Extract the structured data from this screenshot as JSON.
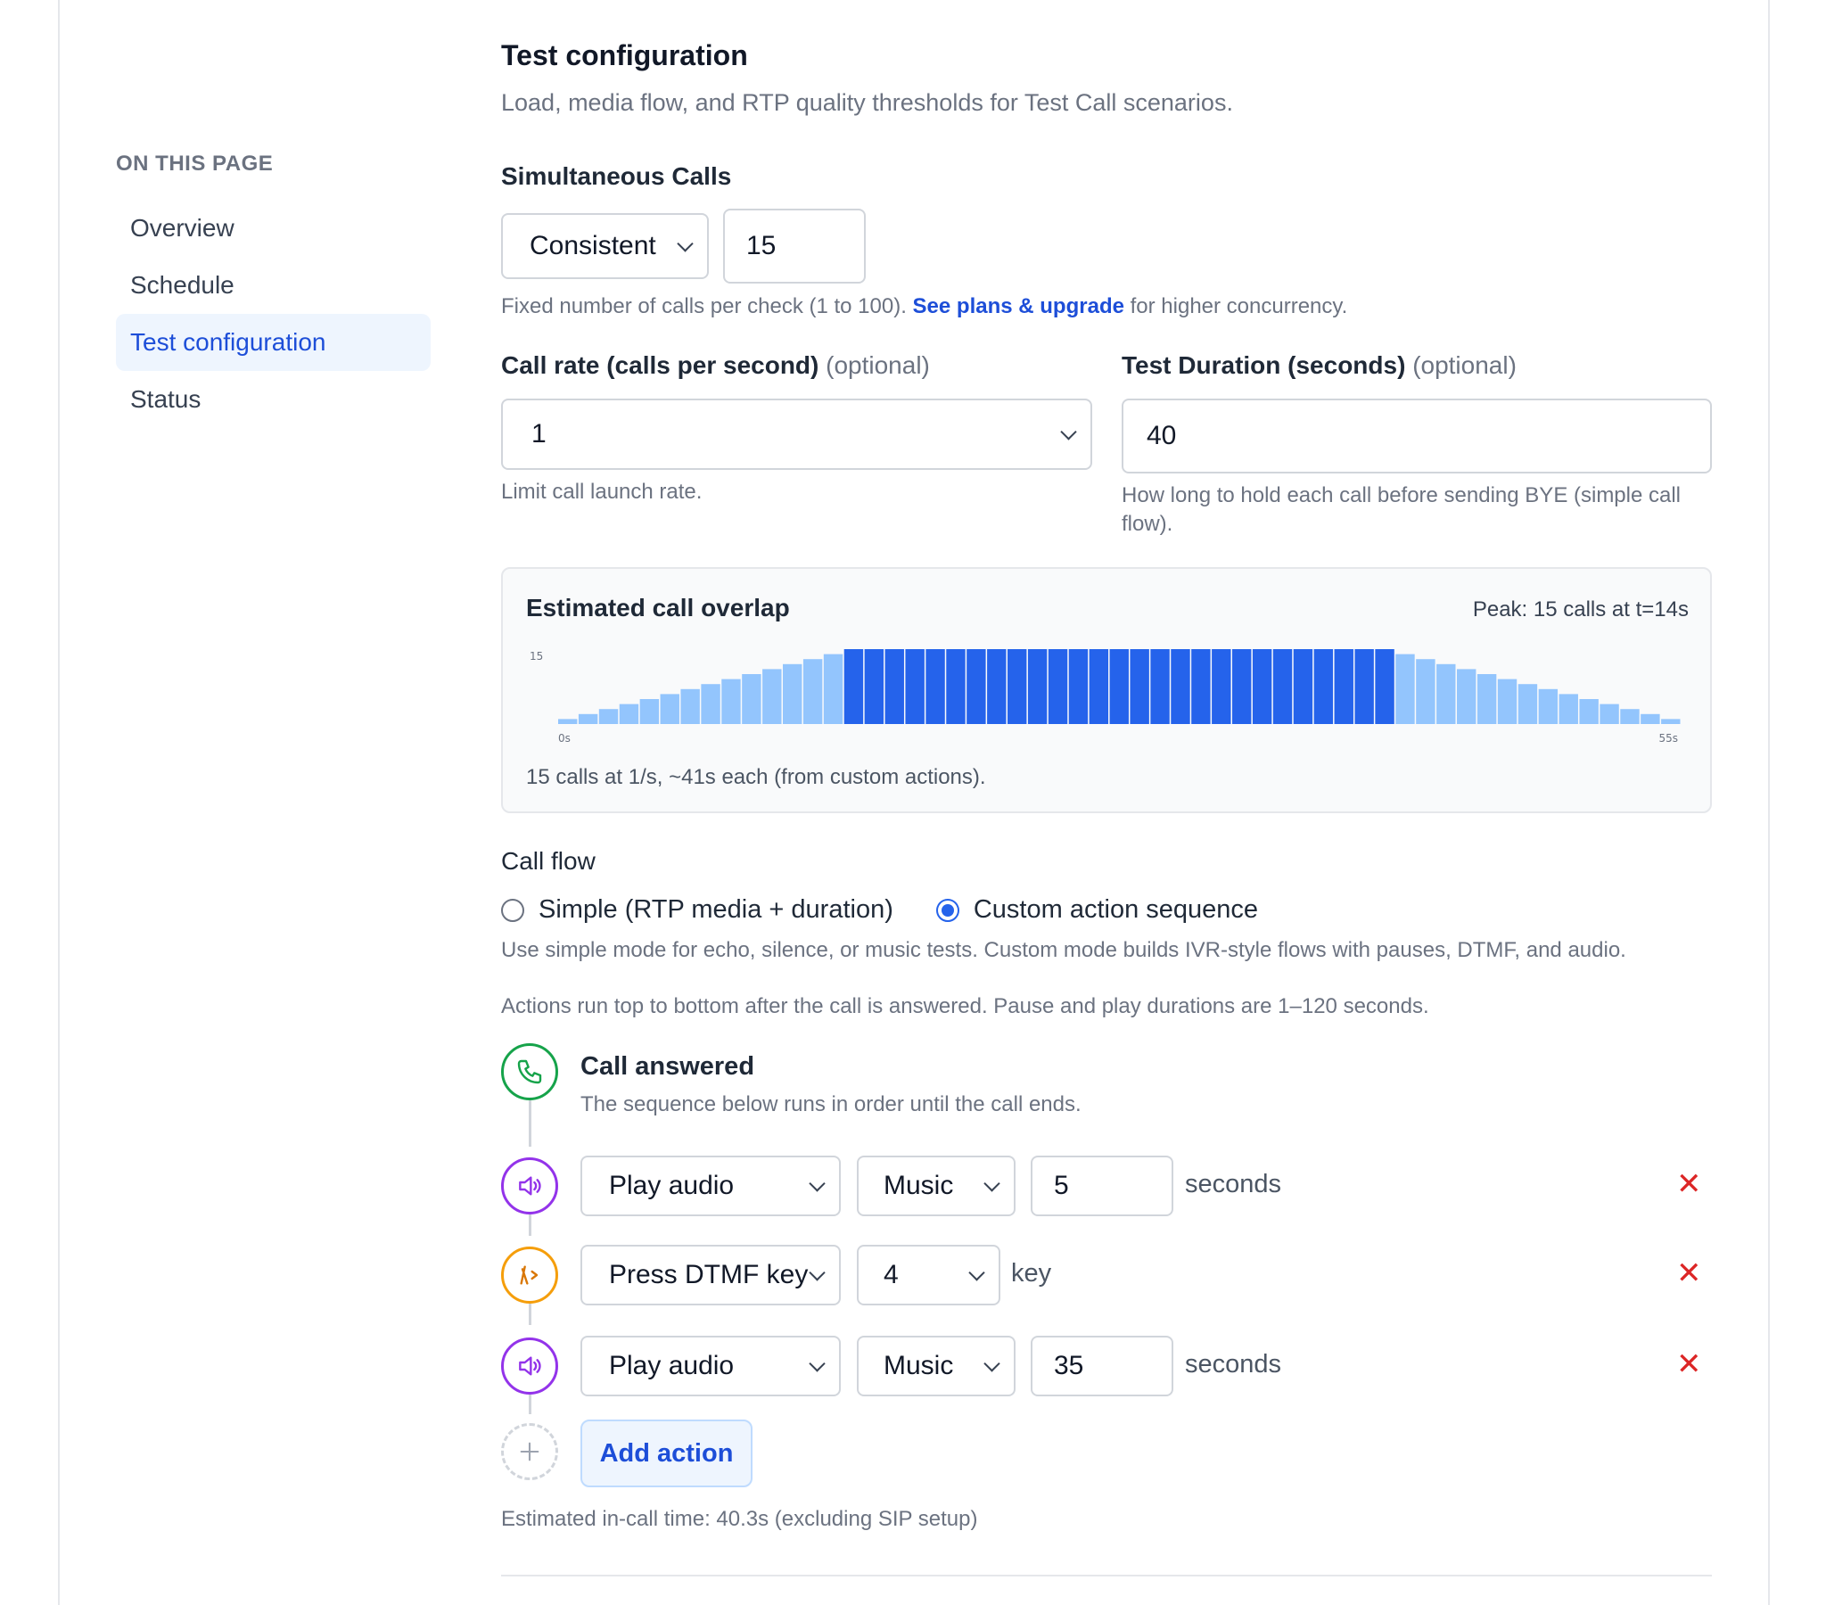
{
  "sidebar": {
    "heading": "ON THIS PAGE",
    "items": [
      {
        "label": "Overview"
      },
      {
        "label": "Schedule"
      },
      {
        "label": "Test configuration",
        "active": true
      },
      {
        "label": "Status"
      }
    ]
  },
  "header": {
    "title": "Test configuration",
    "subtitle": "Load, media flow, and RTP quality thresholds for Test Call scenarios."
  },
  "simultaneous": {
    "label": "Simultaneous Calls",
    "mode": "Consistent",
    "value": "15",
    "help_before": "Fixed number of calls per check (1 to 100).",
    "help_link": "See plans & upgrade",
    "help_after": "for higher concurrency."
  },
  "call_rate": {
    "label": "Call rate (calls per second)",
    "optional": "(optional)",
    "value": "1",
    "help": "Limit call launch rate."
  },
  "duration": {
    "label": "Test Duration (seconds)",
    "optional": "(optional)",
    "value": "40",
    "help": "How long to hold each call before sending BYE (simple call flow)."
  },
  "overlap": {
    "title": "Estimated call overlap",
    "peak": "Peak: 15 calls at t=14s",
    "note": "15 calls at 1/s, ~41s each (from custom actions)."
  },
  "chart_data": {
    "type": "bar",
    "title": "Estimated call overlap",
    "y_tick_label": "15",
    "x_tick_labels": [
      "0s",
      "55s"
    ],
    "x": [
      0,
      1,
      2,
      3,
      4,
      5,
      6,
      7,
      8,
      9,
      10,
      11,
      12,
      13,
      14,
      15,
      16,
      17,
      18,
      19,
      20,
      21,
      22,
      23,
      24,
      25,
      26,
      27,
      28,
      29,
      30,
      31,
      32,
      33,
      34,
      35,
      36,
      37,
      38,
      39,
      40,
      41,
      42,
      43,
      44,
      45,
      46,
      47,
      48,
      49,
      50,
      51,
      52,
      53,
      54
    ],
    "values": [
      1,
      2,
      3,
      4,
      5,
      6,
      7,
      8,
      9,
      10,
      11,
      12,
      13,
      14,
      15,
      15,
      15,
      15,
      15,
      15,
      15,
      15,
      15,
      15,
      15,
      15,
      15,
      15,
      15,
      15,
      15,
      15,
      15,
      15,
      15,
      15,
      15,
      15,
      15,
      15,
      15,
      14,
      13,
      12,
      11,
      10,
      9,
      8,
      7,
      6,
      5,
      4,
      3,
      2,
      1
    ],
    "peak_value": 15,
    "ylim": [
      0,
      15
    ],
    "colors": {
      "peak": "#2563eb",
      "other": "#93c5fd"
    }
  },
  "call_flow": {
    "label": "Call flow",
    "options": [
      {
        "label": "Simple (RTP media + duration)",
        "selected": false
      },
      {
        "label": "Custom action sequence",
        "selected": true
      }
    ],
    "help": "Use simple mode for echo, silence, or music tests. Custom mode builds IVR-style flows with pauses, DTMF, and audio.",
    "actions_note": "Actions run top to bottom after the call is answered. Pause and play durations are 1–120 seconds.",
    "answered_title": "Call answered",
    "answered_sub": "The sequence below runs in order until the call ends.",
    "steps": [
      {
        "action": "Play audio",
        "param": "Music",
        "value": "5",
        "unit": "seconds",
        "icon": "speaker-icon",
        "color": "#9333ea"
      },
      {
        "action": "Press DTMF key",
        "param": "4",
        "unit": "key",
        "icon": "dtmf-icon",
        "color": "#f59e0b"
      },
      {
        "action": "Play audio",
        "param": "Music",
        "value": "35",
        "unit": "seconds",
        "icon": "speaker-icon",
        "color": "#9333ea"
      }
    ],
    "add_label": "Add action",
    "delete_glyph": "✕",
    "estimate": "Estimated in-call time: 40.3s (excluding SIP setup)"
  },
  "colors": {
    "accent": "#1d4ed8",
    "answered": "#16a34a",
    "delete": "#dc2626"
  }
}
